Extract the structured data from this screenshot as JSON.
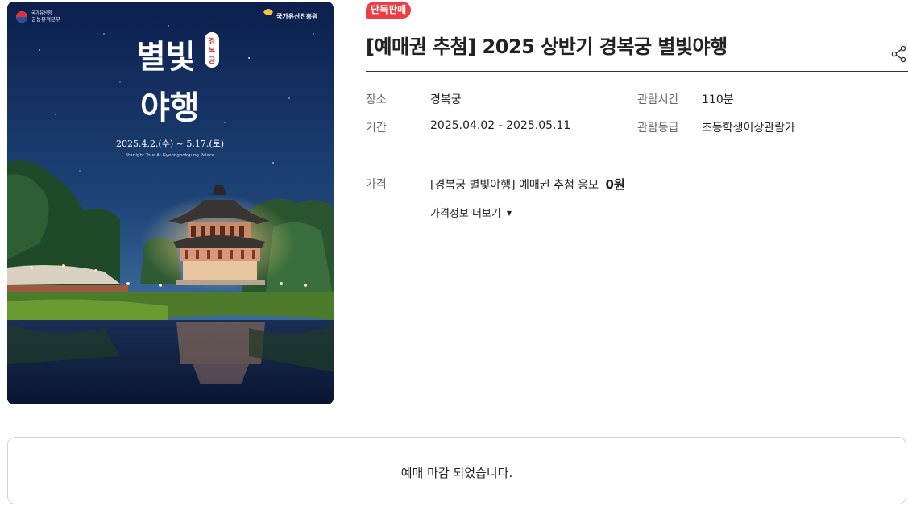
{
  "poster": {
    "org_left": "국가유산청 궁능유적본부",
    "org_right": "국가유산진흥원",
    "title_line1": "별빛",
    "title_line2": "야행",
    "title_vertical": "경복궁",
    "date_text": "2025.4.2.(수) ~ 5.17.(토)",
    "subtitle_en": "Starlight Tour At Gyeongbokgung Palace"
  },
  "badge": "단독판매",
  "title": "[예매권 추첨] 2025 상반기 경복궁 별빛야행",
  "info": {
    "place_label": "장소",
    "place_value": "경복궁",
    "runtime_label": "관람시간",
    "runtime_value": "110분",
    "period_label": "기간",
    "period_value": "2025.04.02 - 2025.05.11",
    "rating_label": "관람등급",
    "rating_value": "초등학생이상관람가"
  },
  "price": {
    "label": "가격",
    "item_text": "[경복궁 별빛야행] 예매권 추첨 응모",
    "amount": "0원",
    "more_link": "가격정보 더보기"
  },
  "status": {
    "closed_text": "예매 마감 되었습니다."
  },
  "icons": {
    "share": "share-icon",
    "caret": "caret-down-icon"
  },
  "colors": {
    "badge": "#ef3e43",
    "sky_top": "#0e2455",
    "sky_bottom": "#2d5a8e"
  }
}
